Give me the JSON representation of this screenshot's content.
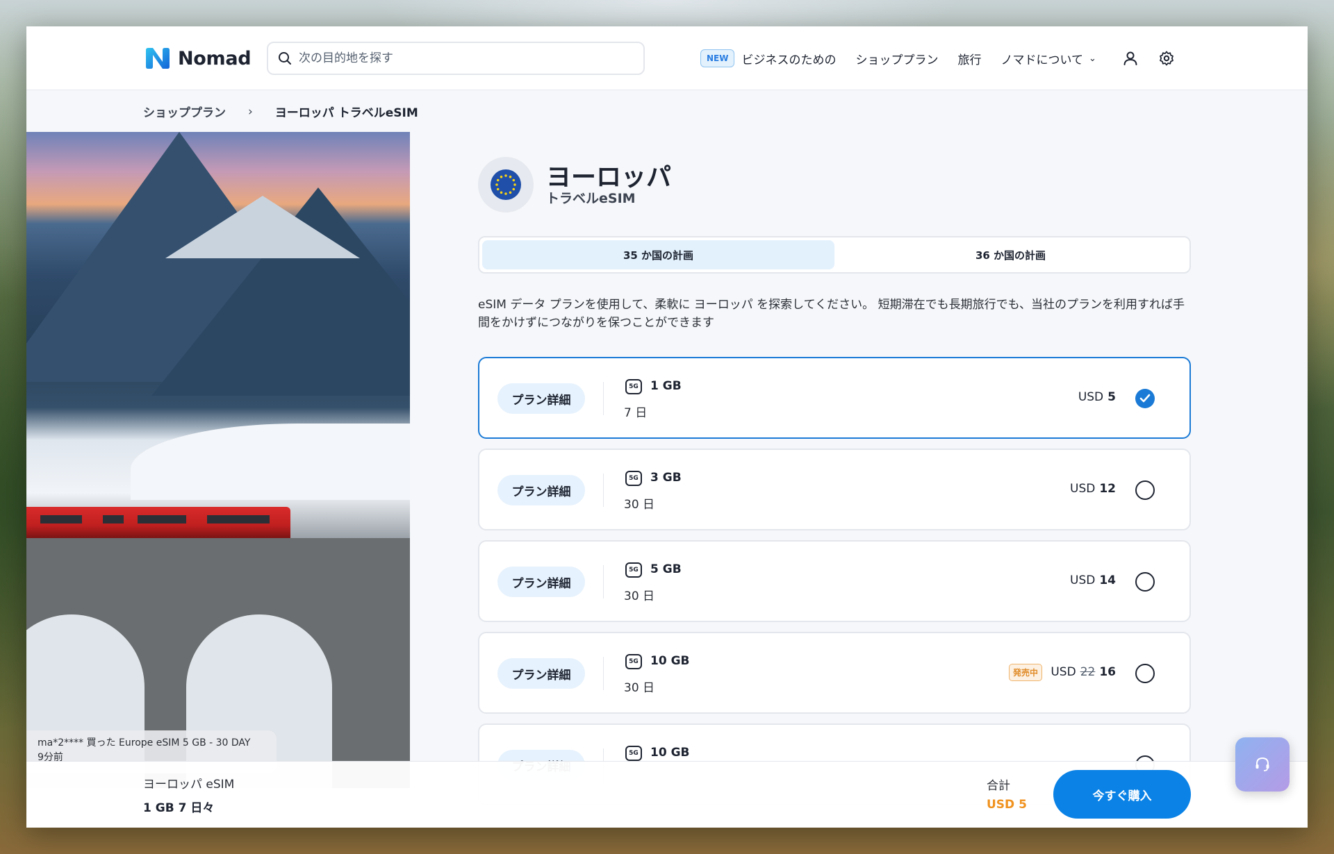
{
  "header": {
    "logo_text": "Nomad",
    "search_placeholder": "次の目的地を探す",
    "nav_new_badge": "NEW",
    "nav_items": [
      "ビジネスのための",
      "ショッププラン",
      "旅行",
      "ノマドについて"
    ]
  },
  "breadcrumb": {
    "first": "ショッププラン",
    "separator": "›",
    "current": "ヨーロッパ トラベルeSIM"
  },
  "toast": {
    "line1": "ma*2**** 買った Europe eSIM 5 GB - 30 DAY",
    "line2": "9分前"
  },
  "country": {
    "title": "ヨーロッパ",
    "subtitle": "トラベルeSIM"
  },
  "tabs": [
    "35 か国の計画",
    "36 か国の計画"
  ],
  "description": "eSIM データ プランを使用して、柔軟に ヨーロッパ を探索してください。 短期滞在でも長期旅行でも、当社のプランを利用すれば手間をかけずにつながりを保つことができます",
  "plans": [
    {
      "detail": "プラン詳細",
      "badge_5g": "5G",
      "data": "1 GB",
      "days": "7 日",
      "currency": "USD",
      "price": "5",
      "old_price": "",
      "sale": "",
      "selected": true
    },
    {
      "detail": "プラン詳細",
      "badge_5g": "5G",
      "data": "3 GB",
      "days": "30 日",
      "currency": "USD",
      "price": "12",
      "old_price": "",
      "sale": "",
      "selected": false
    },
    {
      "detail": "プラン詳細",
      "badge_5g": "5G",
      "data": "5 GB",
      "days": "30 日",
      "currency": "USD",
      "price": "14",
      "old_price": "",
      "sale": "",
      "selected": false
    },
    {
      "detail": "プラン詳細",
      "badge_5g": "5G",
      "data": "10 GB",
      "days": "30 日",
      "currency": "USD",
      "price": "16",
      "old_price": "22",
      "sale": "発売中",
      "selected": false
    },
    {
      "detail": "プラン詳細",
      "badge_5g": "5G",
      "data": "10 GB",
      "days": "",
      "currency": "",
      "price": "",
      "old_price": "",
      "sale": "",
      "selected": false
    }
  ],
  "footer": {
    "product_name": "ヨーロッパ eSIM",
    "selected_plan": "1 GB 7 日々",
    "total_label": "合計",
    "total_value": "USD 5",
    "buy_label": "今すぐ購入"
  },
  "icons": {
    "search": "search-icon",
    "chevron": "chevron-down-icon",
    "user": "user-icon",
    "settings": "gear-icon",
    "check": "check-icon",
    "support": "headset-icon",
    "flag": "eu-flag-icon"
  },
  "colors": {
    "accent": "#0a82e6",
    "selected_border": "#1a7ad6",
    "tab_active": "#e3f1fd",
    "sale": "#e08c2a",
    "total": "#f0921f"
  }
}
